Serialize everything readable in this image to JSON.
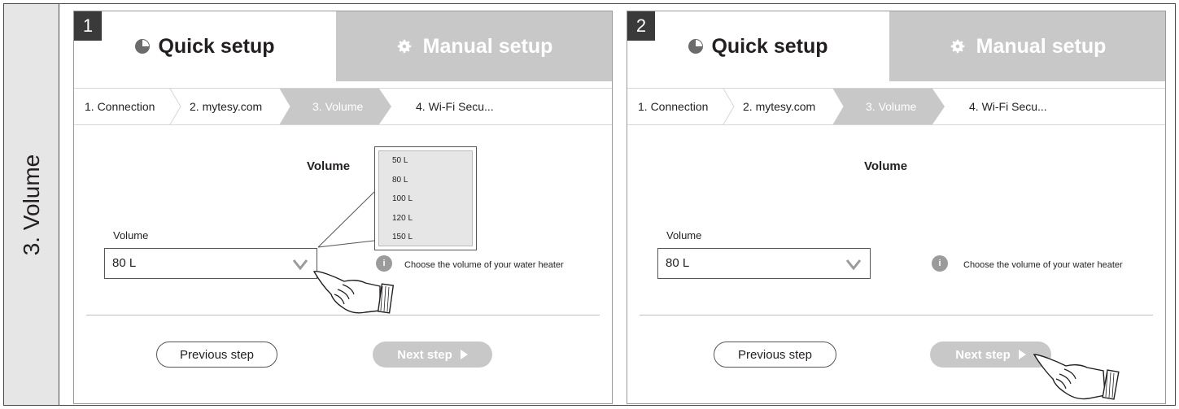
{
  "side_label": "3. Volume",
  "panels": [
    {
      "step": "1",
      "tabs": {
        "quick": "Quick setup",
        "manual": "Manual setup"
      },
      "breadcrumbs": [
        "1. Connection",
        "2. mytesy.com",
        "3. Volume",
        "4. Wi-Fi Secu..."
      ],
      "title": "Volume",
      "field_label": "Volume",
      "select_value": "80 L",
      "dropdown_options": [
        "50 L",
        "80 L",
        "100 L",
        "120 L",
        "150 L"
      ],
      "info_icon": "i",
      "info_text": "Choose the volume of your water heater",
      "prev_label": "Previous step",
      "next_label": "Next step"
    },
    {
      "step": "2",
      "tabs": {
        "quick": "Quick setup",
        "manual": "Manual setup"
      },
      "breadcrumbs": [
        "1. Connection",
        "2. mytesy.com",
        "3. Volume",
        "4. Wi-Fi Secu..."
      ],
      "title": "Volume",
      "field_label": "Volume",
      "select_value": "80 L",
      "info_icon": "i",
      "info_text": "Choose the volume of your water heater",
      "prev_label": "Previous step",
      "next_label": "Next step"
    }
  ],
  "icons": [
    "pie-clock-icon",
    "gear-icon",
    "chevron-down-icon",
    "info-icon",
    "play-icon",
    "pointing-hand-icon"
  ],
  "colors": {
    "dark": "#3a3a3a",
    "inactive": "#c8c8c8",
    "side_bg": "#e6e6e6",
    "text": "#231f20"
  }
}
